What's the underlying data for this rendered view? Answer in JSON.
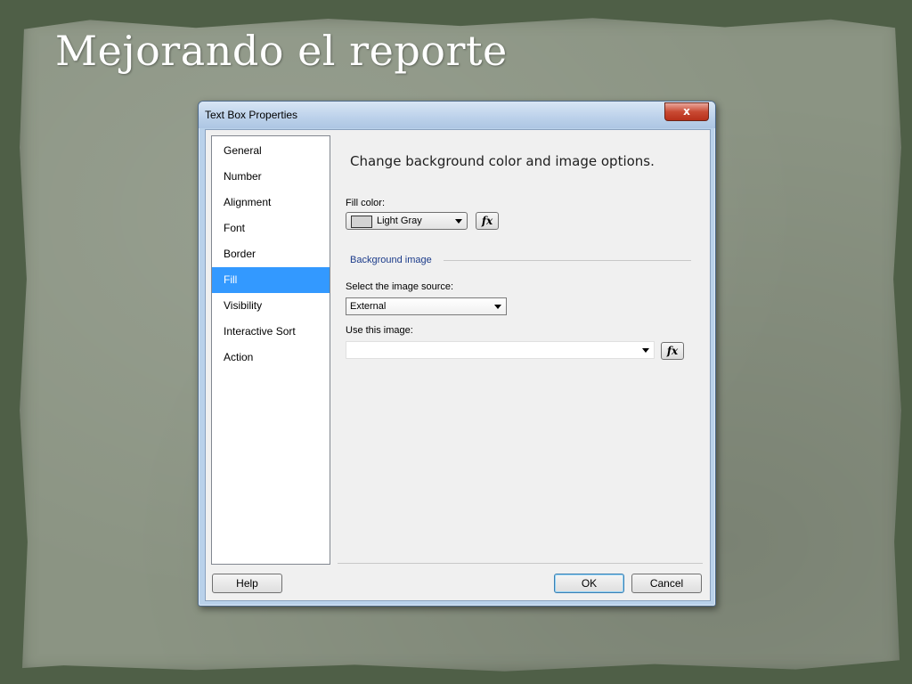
{
  "slide": {
    "title": "Mejorando el reporte"
  },
  "dialog": {
    "title": "Text Box Properties",
    "close_label": "x",
    "nav": [
      "General",
      "Number",
      "Alignment",
      "Font",
      "Border",
      "Fill",
      "Visibility",
      "Interactive Sort",
      "Action"
    ],
    "selected_nav": "Fill",
    "heading": "Change background color and image options.",
    "fill_color_label": "Fill color:",
    "fill_color_value": "Light Gray",
    "fill_color_swatch": "#d3d3d3",
    "fx_label": "fx",
    "background_image_group": "Background image",
    "image_source_label": "Select the image source:",
    "image_source_value": "External",
    "use_image_label": "Use this image:",
    "use_image_value": "",
    "help_label": "Help",
    "ok_label": "OK",
    "cancel_label": "Cancel"
  },
  "colors": {
    "selection": "#3399ff",
    "slide_background": "#8b9483"
  }
}
